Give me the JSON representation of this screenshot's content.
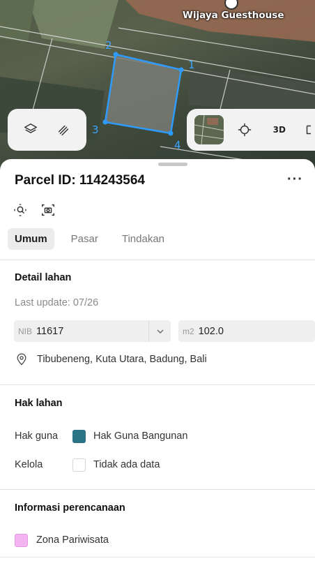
{
  "map": {
    "poi_label": "Wijaya Guesthouse",
    "vertex_labels": [
      "1",
      "2",
      "3",
      "4"
    ],
    "parcel_color": "#2e9bff",
    "toolbar_left": [
      {
        "name": "layers-icon"
      },
      {
        "name": "draw-icon"
      }
    ],
    "toolbar_right": [
      {
        "name": "satellite-thumbnail"
      },
      {
        "name": "locate-icon"
      },
      {
        "label": "3D"
      },
      {
        "name": "more-icon"
      }
    ]
  },
  "sheet": {
    "title": "Parcel ID: 114243564",
    "more_label": "···",
    "tabs": [
      {
        "label": "Umum",
        "active": true
      },
      {
        "label": "Pasar",
        "active": false
      },
      {
        "label": "Tindakan",
        "active": false
      }
    ],
    "land_detail": {
      "title": "Detail lahan",
      "last_update": "Last update: 07/26",
      "nib_label": "NIB",
      "nib_value": "11617",
      "area_label": "m2",
      "area_value": "102.0",
      "address": "Tibubeneng, Kuta Utara, Badung, Bali"
    },
    "land_rights": {
      "title": "Hak lahan",
      "rows": [
        {
          "label": "Hak guna",
          "value": "Hak Guna Bangunan",
          "swatch": "#2a7486"
        },
        {
          "label": "Kelola",
          "value": "Tidak ada data",
          "swatch": "#ffffff"
        }
      ]
    },
    "planning": {
      "title": "Informasi perencanaan",
      "zone": "Zona Pariwisata",
      "zone_color": "#f4b4f2"
    }
  }
}
